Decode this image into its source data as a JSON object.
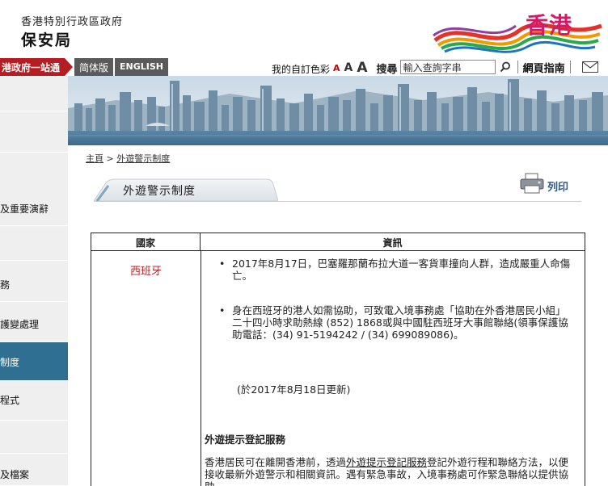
{
  "header": {
    "dept_sub": "香港特別行政區政府",
    "dept_main": "保安局",
    "brand": "香港"
  },
  "nav": {
    "gov_portal": "港政府一站通",
    "lang_sc": "简体版",
    "lang_en": "ENGLISH",
    "colour_scheme": "我的自訂色彩",
    "font_small": "A",
    "font_medium": "A",
    "font_large": "A",
    "search_label": "搜尋",
    "search_placeholder": "輸入查詢字串",
    "site_guide": "網頁指南"
  },
  "sidebar": {
    "items": [
      {
        "label": ""
      },
      {
        "label": ""
      },
      {
        "label": "及重要演辭"
      },
      {
        "label": ""
      },
      {
        "label": "務"
      },
      {
        "label": "護變處理"
      },
      {
        "label": "制度"
      },
      {
        "label": "程式"
      },
      {
        "label": ""
      },
      {
        "label": "及檔案"
      }
    ]
  },
  "breadcrumb": {
    "home": "主頁",
    "separator": " > ",
    "current": "外遊警示制度"
  },
  "page": {
    "title": "外遊警示制度",
    "print_label": "列印"
  },
  "table": {
    "col_country": "國家",
    "col_info": "資訊",
    "country": "西班牙",
    "bullet1": "2017年8月17日，巴塞羅那蘭布拉大道一客貨車撞向人群，造成嚴重人命傷亡。",
    "bullet2": "身在西班牙的港人如需協助，可致電入境事務處「協助在外香港居民小組」二十四小時求助熱線 (852) 1868或與中國駐西班牙大事館聯絡(領事保護協助電話：(34) 91-5194242 / (34) 699089086)。",
    "update_note": "(於2017年8月18日更新)",
    "reg_title": "外遊提示登記服務",
    "reg_body_pre": "香港居民可在離開香港前，透過",
    "reg_body_link": "外遊提示登記服務",
    "reg_body_post": "登記外遊行程和聯絡方法，以便接收最新外遊警示和相關資訊。遇有緊急事故，入境事務處可作緊急聯絡以提供協助。"
  },
  "colors": {
    "brand_magenta": "#d2196a",
    "nav_red": "#b41e23",
    "sidebar_active": "#2f6f91",
    "country_red": "#b4262d"
  }
}
